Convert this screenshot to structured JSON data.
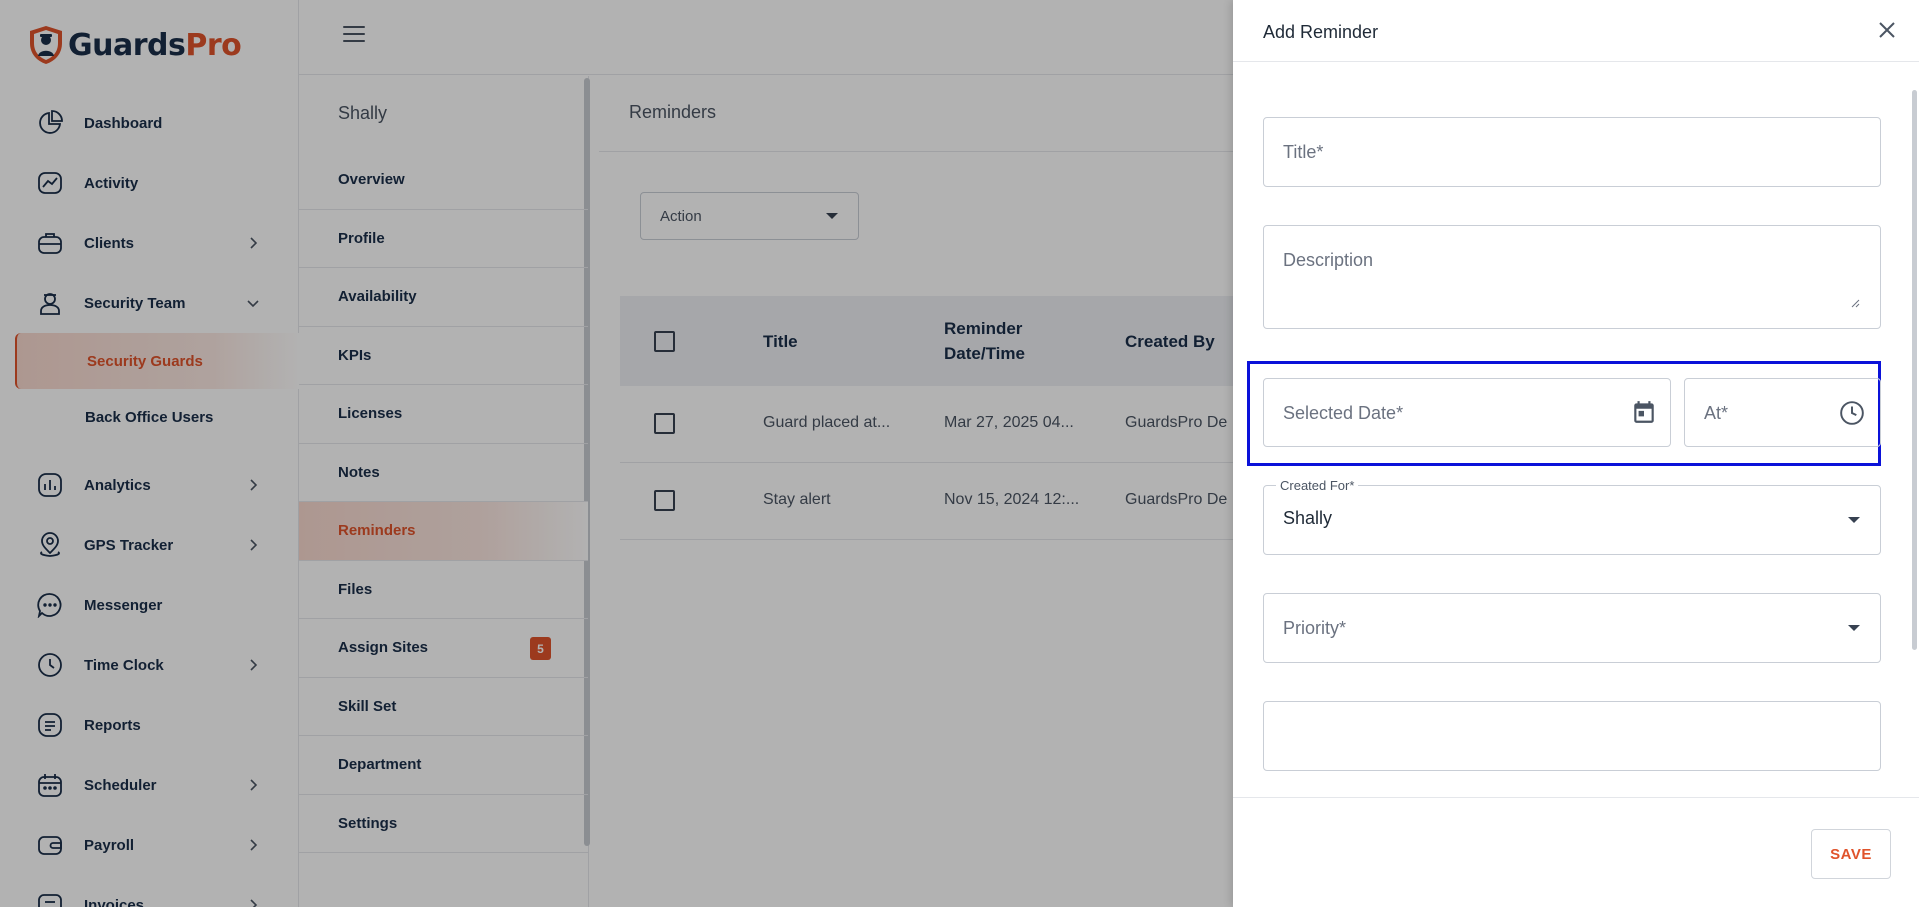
{
  "brand": {
    "name_part1": "Guards",
    "name_part2": "Pro"
  },
  "sidebar": {
    "items": [
      {
        "label": "Dashboard",
        "icon": "pie-chart-icon"
      },
      {
        "label": "Activity",
        "icon": "activity-icon"
      },
      {
        "label": "Clients",
        "icon": "briefcase-icon",
        "expandable": true
      },
      {
        "label": "Security Team",
        "icon": "guard-icon",
        "expanded": true,
        "subitems": [
          {
            "label": "Security Guards",
            "active": true
          },
          {
            "label": "Back Office Users"
          }
        ]
      },
      {
        "label": "Analytics",
        "icon": "analytics-icon",
        "expandable": true
      },
      {
        "label": "GPS Tracker",
        "icon": "location-pin-icon",
        "expandable": true
      },
      {
        "label": "Messenger",
        "icon": "chat-icon"
      },
      {
        "label": "Time Clock",
        "icon": "clock-icon",
        "expandable": true
      },
      {
        "label": "Reports",
        "icon": "report-icon"
      },
      {
        "label": "Scheduler",
        "icon": "calendar-icon",
        "expandable": true
      },
      {
        "label": "Payroll",
        "icon": "wallet-icon",
        "expandable": true
      },
      {
        "label": "Invoices",
        "icon": "invoice-icon",
        "expandable": true
      }
    ]
  },
  "profile_tabs": {
    "person_name": "Shally",
    "items": [
      {
        "label": "Overview"
      },
      {
        "label": "Profile"
      },
      {
        "label": "Availability"
      },
      {
        "label": "KPIs"
      },
      {
        "label": "Licenses"
      },
      {
        "label": "Notes"
      },
      {
        "label": "Reminders",
        "active": true
      },
      {
        "label": "Files"
      },
      {
        "label": "Assign Sites",
        "badge": "5"
      },
      {
        "label": "Skill Set"
      },
      {
        "label": "Department"
      },
      {
        "label": "Settings"
      }
    ]
  },
  "main": {
    "title": "Reminders",
    "action_select": {
      "value": "Action"
    },
    "table": {
      "headers": {
        "title": "Title",
        "datetime": "Reminder Date/Time",
        "created_by": "Created By"
      },
      "rows": [
        {
          "title": "Guard placed at...",
          "datetime": "Mar 27, 2025 04...",
          "created_by": "GuardsPro De"
        },
        {
          "title": "Stay alert",
          "datetime": "Nov 15, 2024 12:...",
          "created_by": "GuardsPro De"
        }
      ]
    }
  },
  "drawer": {
    "title": "Add Reminder",
    "fields": {
      "title_placeholder": "Title*",
      "description_placeholder": "Description",
      "date_placeholder": "Selected Date*",
      "time_placeholder": "At*",
      "created_for_label": "Created For*",
      "created_for_value": "Shally",
      "priority_placeholder": "Priority*"
    },
    "save_label": "SAVE"
  },
  "colors": {
    "accent": "#e0532b",
    "navy": "#1b2f4a",
    "highlight": "#0b12d9"
  }
}
